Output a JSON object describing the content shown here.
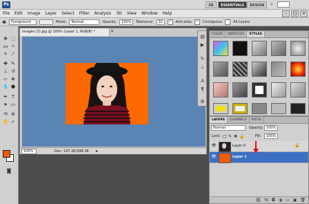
{
  "app": {
    "logo": "Ps",
    "workspaces": [
      "3D",
      "ESSENTIALS",
      "DESIGN"
    ],
    "active_workspace": "ESSENTIALS",
    "window_controls": [
      "–",
      "□",
      "×"
    ]
  },
  "menu": [
    "File",
    "Edit",
    "Image",
    "Layer",
    "Select",
    "Filter",
    "Analysis",
    "3D",
    "View",
    "Window",
    "Help"
  ],
  "options": {
    "fill_source": "Foreground",
    "mode_label": "Mode:",
    "mode_value": "Normal",
    "opacity_label": "Opacity:",
    "opacity_value": "100%",
    "tolerance_label": "Tolerance:",
    "tolerance_value": "32",
    "anti_alias": "Anti-alias",
    "contiguous": "Contiguous",
    "all_layers": "All Layers"
  },
  "colors": {
    "foreground": "#f25c05",
    "background": "#ffffff",
    "canvas_bg": "#5a84b3",
    "layer_selected": "#3a6fc4"
  },
  "document": {
    "tab_title": "images (3).jpg @ 100% (Layer 1, RGB/8) *",
    "zoom": "100%",
    "doc_info": "Doc: 147.2K/396.3K"
  },
  "styles_panel": {
    "tabs": [
      "COLOR",
      "SWATCHES",
      "STYLES"
    ],
    "active_tab": "STYLES"
  },
  "layers": {
    "tabs": [
      "LAYERS",
      "CHANNELS",
      "PATHS"
    ],
    "active_tab": "LAYERS",
    "blend_mode": "Normal",
    "opacity_label": "Opacity:",
    "opacity_value": "100%",
    "lock_label": "Lock:",
    "fill_label": "Fill:",
    "fill_value": "100%",
    "items": [
      {
        "name": "Layer 0",
        "selected": false
      },
      {
        "name": "Layer 1",
        "selected": true
      }
    ]
  }
}
